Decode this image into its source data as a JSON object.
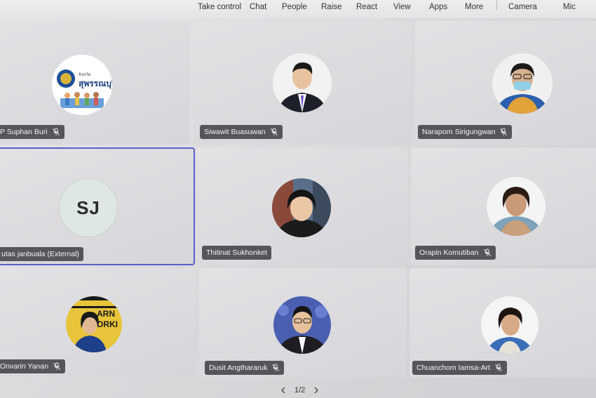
{
  "toolbar": {
    "take_control": "Take control",
    "chat": "Chat",
    "people": "People",
    "raise": "Raise",
    "react": "React",
    "view": "View",
    "apps": "Apps",
    "more": "More",
    "camera": "Camera",
    "mic": "Mic"
  },
  "participants": [
    {
      "name": "P Suphan Buri",
      "logo_title": "สุพรรณบุรี",
      "logo_small": "จังหวัด",
      "muted": true
    },
    {
      "name": "Siwawit Buasuwan",
      "muted": true
    },
    {
      "name": "Naraporn Sirigungwan",
      "muted": true
    },
    {
      "name": "utas janbuala (External)",
      "initials": "SJ",
      "muted": false,
      "active": true
    },
    {
      "name": "Thitinat Sukhonket",
      "muted": false
    },
    {
      "name": "Orapin Komutiban",
      "muted": true
    },
    {
      "name": "Onvarin Yanan",
      "muted": true,
      "backdrop_text": "ARN\nORKI"
    },
    {
      "name": "Dusit Angthararuk",
      "muted": true
    },
    {
      "name": "Chuanchom Iamsa-Art",
      "muted": true
    }
  ],
  "pager": {
    "label": "1/2"
  },
  "colors": {
    "active_border": "#5b5fc7",
    "name_tag_bg": "#55565c"
  },
  "icons": {
    "muted": "mic-off-icon",
    "prev": "chevron-left-icon",
    "next": "chevron-right-icon"
  }
}
